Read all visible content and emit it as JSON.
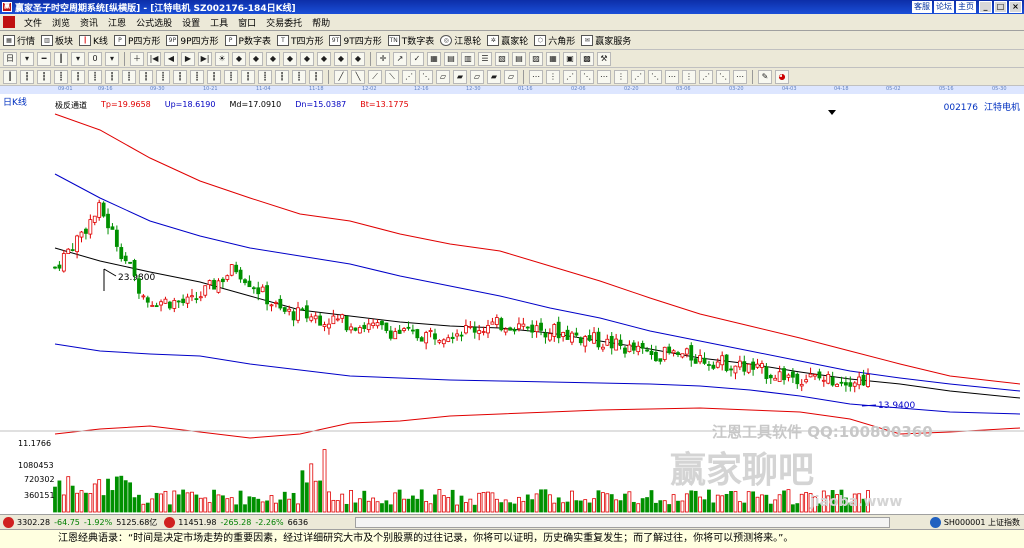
{
  "window": {
    "title": "赢家圣子时空周期系统[纵横版] - [江特电机  SZ002176-184日K线]",
    "links": [
      "客服",
      "论坛",
      "主页"
    ],
    "controls": [
      "_",
      "□",
      "×"
    ]
  },
  "menu": [
    "文件",
    "浏览",
    "资讯",
    "江恩",
    "公式选股",
    "设置",
    "工具",
    "窗口",
    "交易委托",
    "帮助"
  ],
  "toolbar1": [
    {
      "label": "行情",
      "icon": "table-icon"
    },
    {
      "label": "板块",
      "icon": "sector-icon"
    },
    {
      "label": "K线",
      "icon": "candlestick-icon"
    },
    {
      "label": "P四方形",
      "icon": "p-square-icon"
    },
    {
      "label": "9P四方形",
      "icon": "9p-square-icon"
    },
    {
      "label": "P数字表",
      "icon": "p-number-icon"
    },
    {
      "label": "T四方形",
      "icon": "t-square-icon"
    },
    {
      "label": "9T四方形",
      "icon": "9t-square-icon"
    },
    {
      "label": "T数字表",
      "icon": "t-number-icon"
    },
    {
      "label": "江恩轮",
      "icon": "gann-wheel-icon"
    },
    {
      "label": "赢家轮",
      "icon": "winner-wheel-icon"
    },
    {
      "label": "六角形",
      "icon": "hexagon-icon"
    },
    {
      "label": "赢家服务",
      "icon": "service-icon"
    }
  ],
  "chart": {
    "period": "日K线",
    "indicator_name": "极反通道",
    "tp": "Tp=19.9658",
    "up": "Up=18.6190",
    "md": "Md=17.0910",
    "dn": "Dn=15.0387",
    "bt": "Bt=13.1775",
    "stock_code": "002176",
    "stock_name": "江特电机",
    "high_label": "23.9800",
    "low_label": "13.9400",
    "vol_labels": [
      "11.1766",
      "1080453",
      "720302",
      "360151"
    ],
    "dates": [
      "09-01",
      "09-16",
      "09-30",
      "10-21",
      "11-04",
      "11-18",
      "12-02",
      "12-16",
      "12-30",
      "01-16",
      "02-06",
      "02-20",
      "03-06",
      "03-20",
      "04-03",
      "04-18",
      "05-02",
      "05-16",
      "05-30"
    ],
    "colors": {
      "up": "#e00000",
      "down": "#009000",
      "middle": "#000000",
      "band_blue": "#0000c8",
      "band_red": "#e00000"
    }
  },
  "chart_data": {
    "type": "candlestick",
    "title": "江特电机 SZ002176 日K线",
    "price_range": [
      11.1766,
      30.0
    ],
    "volume_ticks": [
      360151,
      720302,
      1080453
    ],
    "x": [
      "09-01",
      "09-16",
      "09-30",
      "10-21",
      "11-04",
      "11-18",
      "12-02",
      "12-16",
      "12-30",
      "01-16",
      "02-06",
      "02-20",
      "03-06",
      "03-20",
      "04-03",
      "04-18",
      "05-02",
      "05-16",
      "05-30"
    ],
    "close_approx": [
      20.5,
      23.98,
      18.6,
      18.4,
      20.5,
      17.9,
      17.5,
      17.0,
      16.5,
      16.8,
      17.2,
      16.8,
      16.2,
      15.5,
      15.3,
      14.8,
      14.2,
      13.94,
      13.94
    ],
    "annotations": [
      {
        "text": "23.9800",
        "type": "high"
      },
      {
        "text": "13.9400",
        "type": "low"
      }
    ]
  },
  "watermark": {
    "line1": "江恩工具软件  QQ:100800360",
    "line2": "赢家聊吧",
    "line3": "jiaoba.www"
  },
  "status": {
    "sh_index": "3302.28",
    "sh_change": "-64.75",
    "sh_pct": "-1.92%",
    "sh_amount": "5125.68亿",
    "sz_index": "11451.98",
    "sz_change": "-265.28",
    "sz_pct": "-2.26%",
    "sz_amount": "6636",
    "right_label": "SH000001 上证指数"
  },
  "quote": "江恩经典语录：“时间是决定市场走势的重要因素，经过详细研究大市及个别股票的过往记录，你将可以证明，历史确实重复发生；而了解过往，你将可以预测将来。”。"
}
